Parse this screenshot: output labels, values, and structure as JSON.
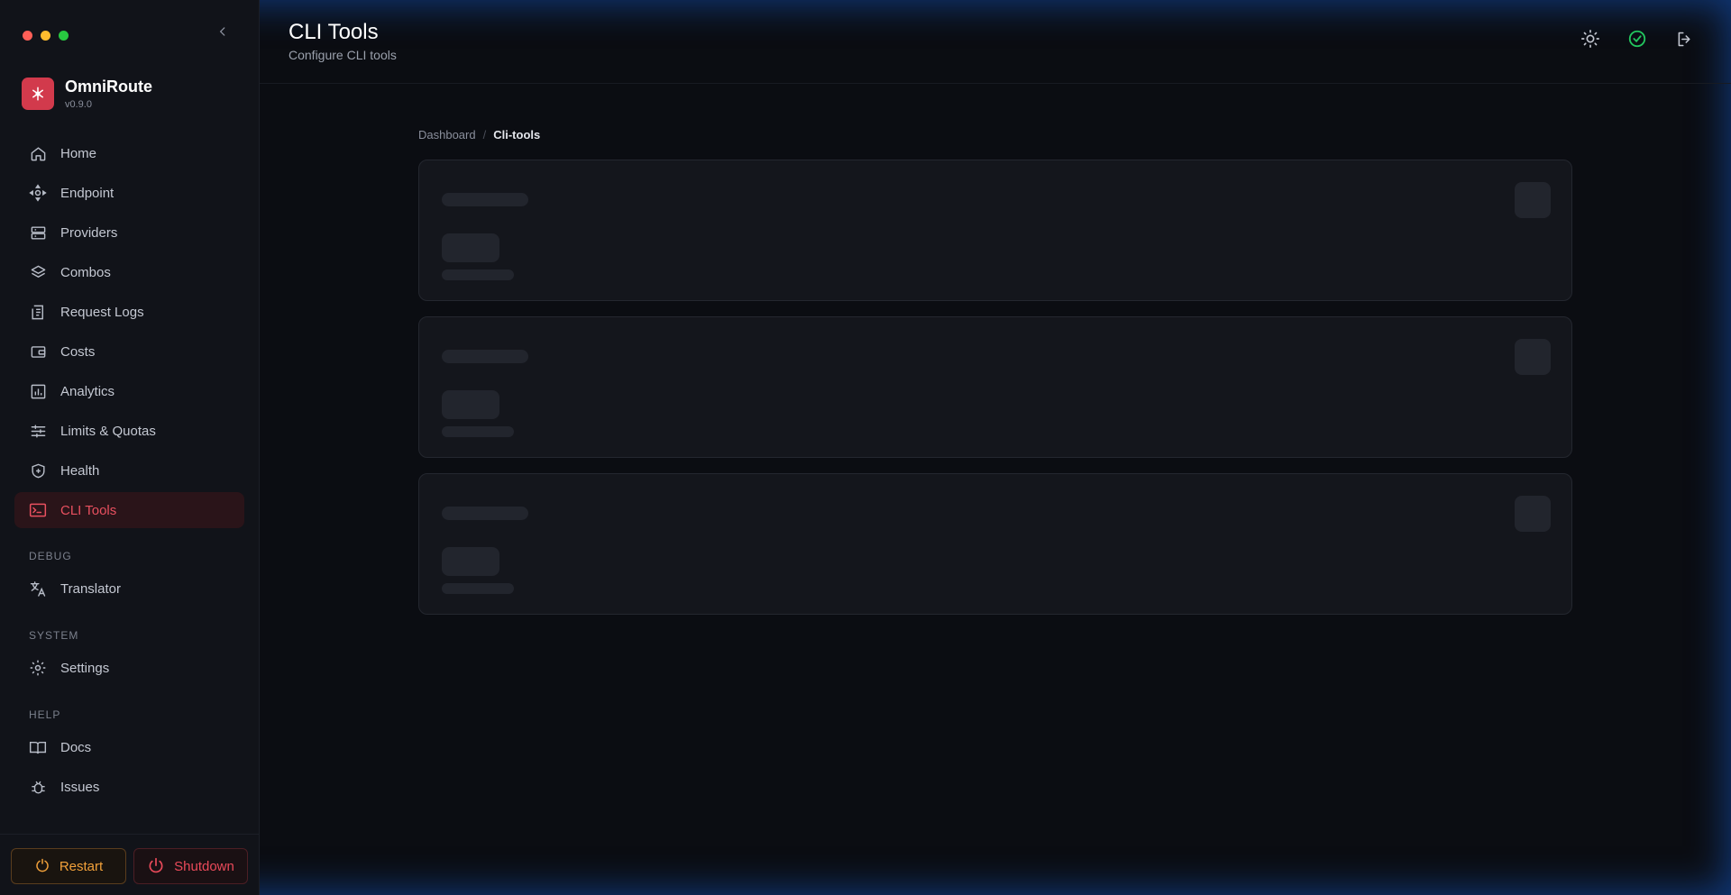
{
  "window": {
    "controls": [
      "close",
      "minimize",
      "zoom"
    ],
    "colors": [
      "#ff5f57",
      "#febc2e",
      "#28c840"
    ]
  },
  "brand": {
    "name": "OmniRoute",
    "version": "v0.9.0",
    "accent": "#d23a4c"
  },
  "sidebar": {
    "items": [
      {
        "label": "Home",
        "icon": "home-icon"
      },
      {
        "label": "Endpoint",
        "icon": "endpoint-icon"
      },
      {
        "label": "Providers",
        "icon": "server-icon"
      },
      {
        "label": "Combos",
        "icon": "layers-icon"
      },
      {
        "label": "Request Logs",
        "icon": "receipt-icon"
      },
      {
        "label": "Costs",
        "icon": "wallet-icon"
      },
      {
        "label": "Analytics",
        "icon": "bar-chart-icon"
      },
      {
        "label": "Limits & Quotas",
        "icon": "sliders-icon"
      },
      {
        "label": "Health",
        "icon": "shield-icon"
      },
      {
        "label": "CLI Tools",
        "icon": "terminal-icon",
        "active": true
      }
    ],
    "debug": {
      "label": "DEBUG",
      "items": [
        {
          "label": "Translator",
          "icon": "translate-icon"
        }
      ]
    },
    "system": {
      "label": "SYSTEM",
      "items": [
        {
          "label": "Settings",
          "icon": "gear-icon"
        }
      ]
    },
    "help": {
      "label": "HELP",
      "items": [
        {
          "label": "Docs",
          "icon": "book-icon"
        },
        {
          "label": "Issues",
          "icon": "bug-icon"
        }
      ]
    },
    "restart_label": "Restart",
    "shutdown_label": "Shutdown"
  },
  "header": {
    "title": "CLI Tools",
    "subtitle": "Configure CLI tools",
    "icons": [
      "sun-icon",
      "check-circle-icon",
      "logout-icon"
    ]
  },
  "breadcrumb": {
    "parent": "Dashboard",
    "separator": "/",
    "current": "Cli-tools"
  },
  "colors": {
    "active": "#e8505f",
    "restart": "#f2a13a",
    "shutdown": "#ea4a5a",
    "status_ok": "#22c55e"
  }
}
